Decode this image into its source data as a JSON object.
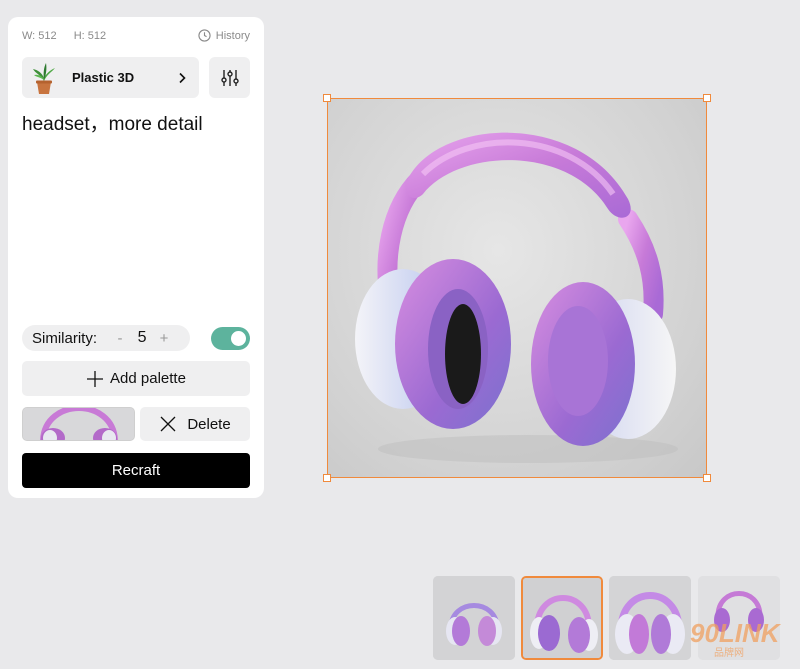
{
  "panel": {
    "width_label": "W: 512",
    "height_label": "H: 512",
    "history_label": "History",
    "style_label": "Plastic 3D",
    "prompt": "headset，more detail",
    "similarity": {
      "label": "Similarity:",
      "minus": "-",
      "value": "5",
      "plus": "+",
      "toggle_on": true
    },
    "add_palette_label": "Add palette",
    "delete_label": "Delete",
    "recraft_label": "Recraft"
  },
  "canvas": {
    "selection_color": "#f08a3c"
  },
  "thumbnails": {
    "count": 4,
    "selected_index": 1
  },
  "watermark": {
    "text": "90LINK",
    "subtext": "品牌网"
  },
  "colors": {
    "accent": "#f08a3c",
    "toggle": "#5db39d",
    "primary_button": "#000000"
  }
}
